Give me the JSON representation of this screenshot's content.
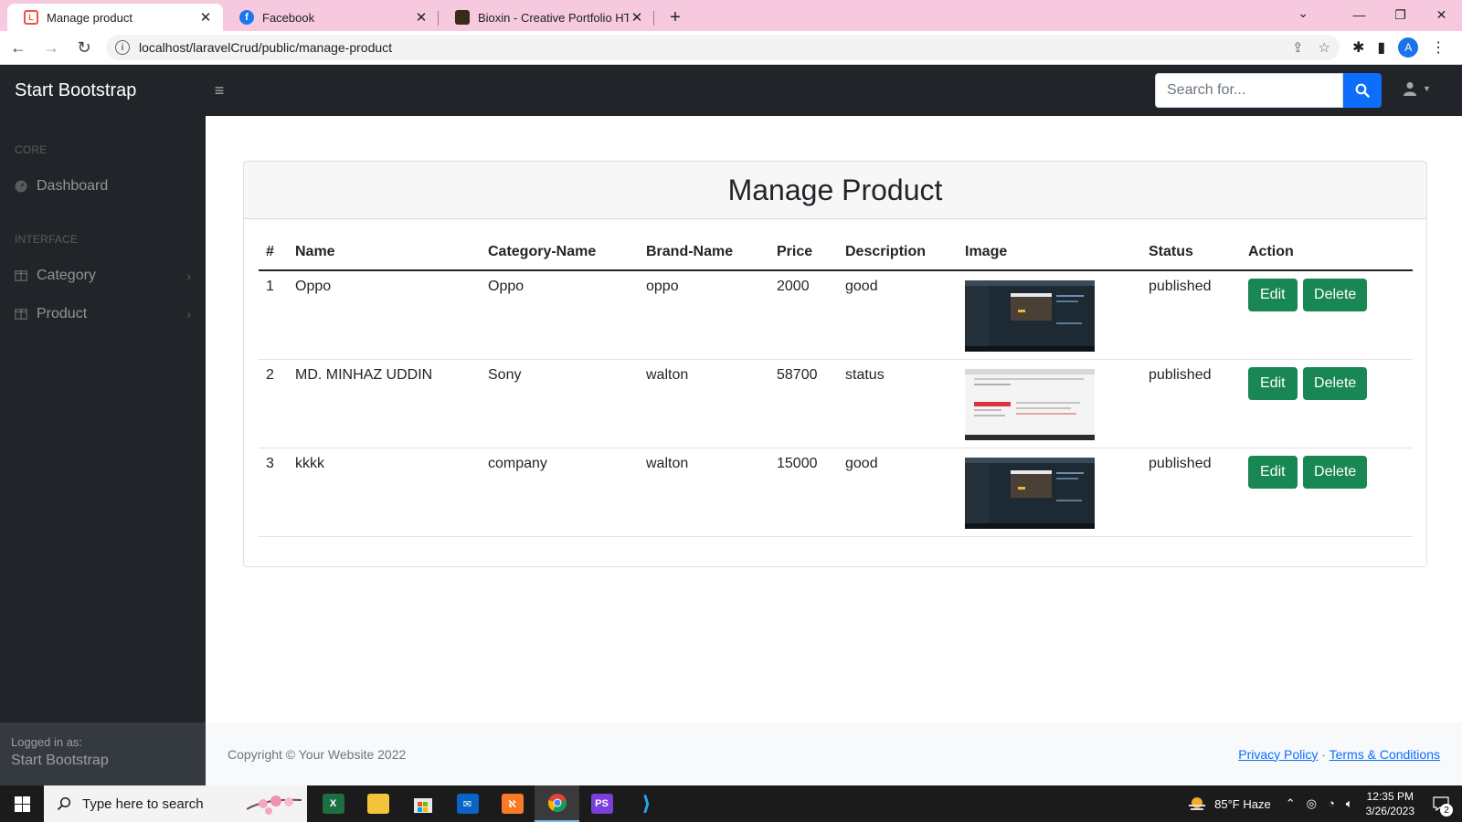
{
  "browser": {
    "tabs": [
      {
        "title": "Manage product",
        "favicon": "laravel-icon",
        "active": true
      },
      {
        "title": "Facebook",
        "favicon": "facebook-icon",
        "active": false
      },
      {
        "title": "Bioxin - Creative Portfolio HTML",
        "favicon": "bioxin-icon",
        "active": false
      }
    ],
    "url": "localhost/laravelCrud/public/manage-product",
    "profile_initial": "A"
  },
  "navbar": {
    "brand": "Start Bootstrap",
    "search_placeholder": "Search for..."
  },
  "sidebar": {
    "sections": [
      {
        "heading": "Core",
        "items": [
          {
            "label": "Dashboard",
            "icon": "dashboard-icon"
          }
        ]
      },
      {
        "heading": "Interface",
        "items": [
          {
            "label": "Category",
            "icon": "columns-icon"
          },
          {
            "label": "Product",
            "icon": "columns-icon"
          }
        ]
      }
    ],
    "footer": {
      "logged_in_label": "Logged in as:",
      "user": "Start Bootstrap"
    }
  },
  "main": {
    "title": "Manage Product",
    "columns": [
      "#",
      "Name",
      "Category-Name",
      "Brand-Name",
      "Price",
      "Description",
      "Image",
      "Status",
      "Action"
    ],
    "rows": [
      {
        "id": "1",
        "name": "Oppo",
        "category": "Oppo",
        "brand": "oppo",
        "price": "2000",
        "description": "good",
        "image": "dark-screenshot",
        "status": "published"
      },
      {
        "id": "2",
        "name": "MD. MINHAZ UDDIN",
        "category": "Sony",
        "brand": "walton",
        "price": "58700",
        "description": "status",
        "image": "light-screenshot",
        "status": "published"
      },
      {
        "id": "3",
        "name": "kkkk",
        "category": "company",
        "brand": "walton",
        "price": "15000",
        "description": "good",
        "image": "dark-screenshot",
        "status": "published"
      }
    ],
    "edit_label": "Edit",
    "delete_label": "Delete"
  },
  "footer": {
    "copyright": "Copyright © Your Website 2022",
    "privacy": "Privacy Policy",
    "separator": "·",
    "terms": "Terms & Conditions"
  },
  "taskbar": {
    "search_placeholder": "Type here to search",
    "weather": "85°F  Haze",
    "time": "12:35 PM",
    "date": "3/26/2023",
    "notifications": "2"
  },
  "colors": {
    "sidebar_bg": "#212529",
    "accent": "#0d6efd",
    "success": "#198754",
    "tabstrip": "#f6c9df"
  }
}
